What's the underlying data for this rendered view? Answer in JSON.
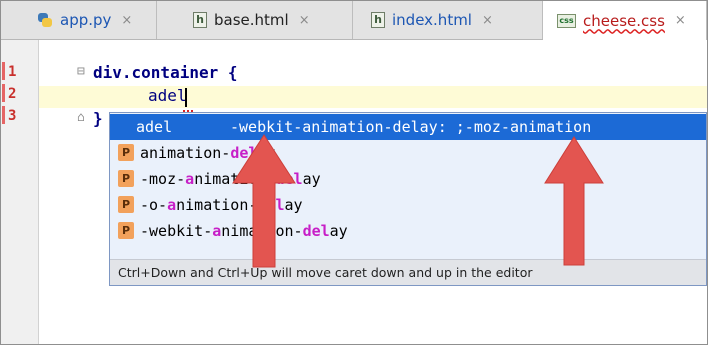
{
  "tabs": [
    {
      "label": "app.py",
      "icon": "python-file-icon",
      "close": "×"
    },
    {
      "label": "base.html",
      "icon": "html-file-icon",
      "close": "×"
    },
    {
      "label": "index.html",
      "icon": "html-file-icon",
      "close": "×"
    },
    {
      "label": "cheese.css",
      "icon": "css-file-icon",
      "close": "×"
    }
  ],
  "icon_text": {
    "html": "h",
    "css": "css"
  },
  "gutter": {
    "lines": [
      "1",
      "2",
      "3"
    ]
  },
  "code": {
    "line1": "div.container {",
    "line2": "adel",
    "line3": "}"
  },
  "completion": {
    "selected": {
      "left": "adel",
      "right": "-webkit-animation-delay: ;-moz-animation"
    },
    "items": [
      {
        "icon": "P",
        "parts": [
          [
            "animation-",
            ""
          ],
          [
            "d",
            "hl"
          ],
          [
            "el",
            ""
          ],
          [
            "ay",
            ""
          ]
        ],
        "text": "animation-delay"
      },
      {
        "icon": "P",
        "text": "-moz-animation-delay"
      },
      {
        "icon": "P",
        "text": "-o-animation-delay"
      },
      {
        "icon": "P",
        "text": "-webkit-animation-delay"
      }
    ],
    "hint": "Ctrl+Down and Ctrl+Up will move caret down and up in the editor"
  },
  "colors": {
    "selection": "#1c6ad6",
    "arrow": "#e35550",
    "match": "#c71fc7"
  }
}
